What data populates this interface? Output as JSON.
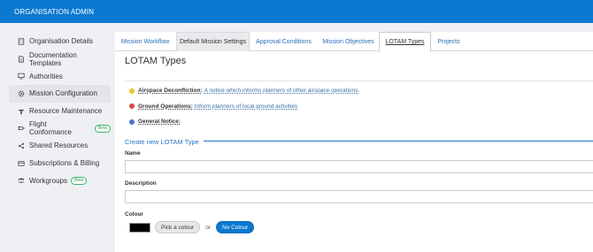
{
  "app": {
    "title": "ORGANISATION ADMIN",
    "accent": "#0b79d0"
  },
  "sidebar": {
    "items": [
      {
        "label": "Organisation Details",
        "icon": "building-icon"
      },
      {
        "label": "Documentation Templates",
        "icon": "document-icon"
      },
      {
        "label": "Authorities",
        "icon": "monitor-icon"
      },
      {
        "label": "Mission Configuration",
        "icon": "gear-icon"
      },
      {
        "label": "Resource Maintenance",
        "icon": "wrench-icon"
      },
      {
        "label": "Flight Conformance",
        "icon": "flight-icon",
        "badge": "Beta"
      },
      {
        "label": "Shared Resources",
        "icon": "share-icon"
      },
      {
        "label": "Subscriptions & Billing",
        "icon": "card-icon"
      },
      {
        "label": "Workgroups",
        "icon": "group-icon",
        "badge": "Beta"
      }
    ]
  },
  "tabs": [
    {
      "label": "Mission Workflow"
    },
    {
      "label": "Default Mission Settings"
    },
    {
      "label": "Approval Conditions"
    },
    {
      "label": "Mission Objectives"
    },
    {
      "label": "LOTAM Types"
    },
    {
      "label": "Projects"
    }
  ],
  "main": {
    "title": "LOTAM Types",
    "lotam_types": [
      {
        "name": "Airspace Deconfliction:",
        "description": "A notice which informs planners of other airspace operations.",
        "color": "#e8c52a"
      },
      {
        "name": "Ground Operations:",
        "description": "Inform planners of local ground activities",
        "color": "#d94848"
      },
      {
        "name": "General Notice:",
        "description": "",
        "color": "#4a73d6"
      }
    ],
    "create": {
      "title": "Create new LOTAM Type",
      "name_label": "Name",
      "name_value": "",
      "description_label": "Description",
      "description_value": "",
      "colour_label": "Colour",
      "swatch_color": "#000000",
      "pick_label": "Pick a colour",
      "or_label": "or",
      "no_colour_label": "No Colour"
    }
  }
}
